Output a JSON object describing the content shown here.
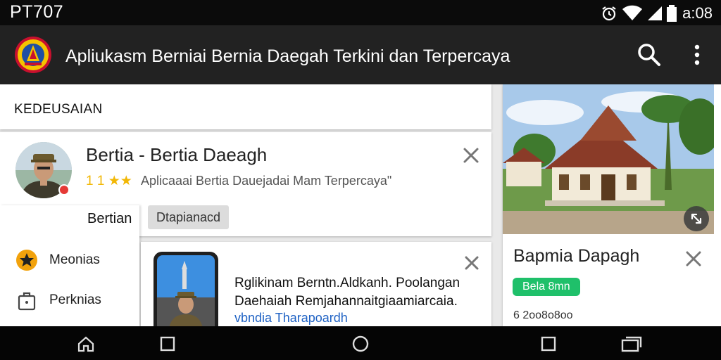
{
  "status_bar": {
    "carrier": "PT707",
    "time": "a:08",
    "icons": [
      "alarm-icon",
      "wifi-icon",
      "signal-icon",
      "battery-icon"
    ]
  },
  "app_bar": {
    "title": "Apliukasm Berniai Bernia Daegah Terkini dan Terpercaya",
    "icons": [
      "logo-emblem",
      "search-icon",
      "more-vert-icon"
    ]
  },
  "section": {
    "title": "KEDEUSAIAN"
  },
  "card1": {
    "title": "Bertia - Bertia Daeagh",
    "rating_number": "1 1",
    "rating_stars": "★★",
    "subtitle": "Aplicaaai Bertia Dauejadai Mam Terpercaya\"",
    "chip_label": "Dtapianacd"
  },
  "drawer": {
    "header": "Bertian",
    "items": [
      {
        "label": "Meonias",
        "icon": "star-icon"
      },
      {
        "label": "Perknias",
        "icon": "bag-icon"
      }
    ]
  },
  "card2": {
    "body": "Rglikinam Berntn.Aldkanh. Poolangan Daehaiah Remjahannaitgiaamiarcaia.",
    "link": "vbndia Tharapoardh"
  },
  "right_card": {
    "title": "Bapmia Dapagh",
    "badge": "Bela 8mn",
    "date": "6 2oo8o8oo"
  },
  "nav_bar": {
    "icons": [
      "home-icon",
      "square-icon",
      "circle-icon",
      "square-icon",
      "recents-icon"
    ]
  },
  "colors": {
    "status_bar": "#0b0b0b",
    "app_bar": "#222222",
    "badge": "#1fc06a",
    "link": "#1f62c4",
    "star": "#f2b705"
  }
}
